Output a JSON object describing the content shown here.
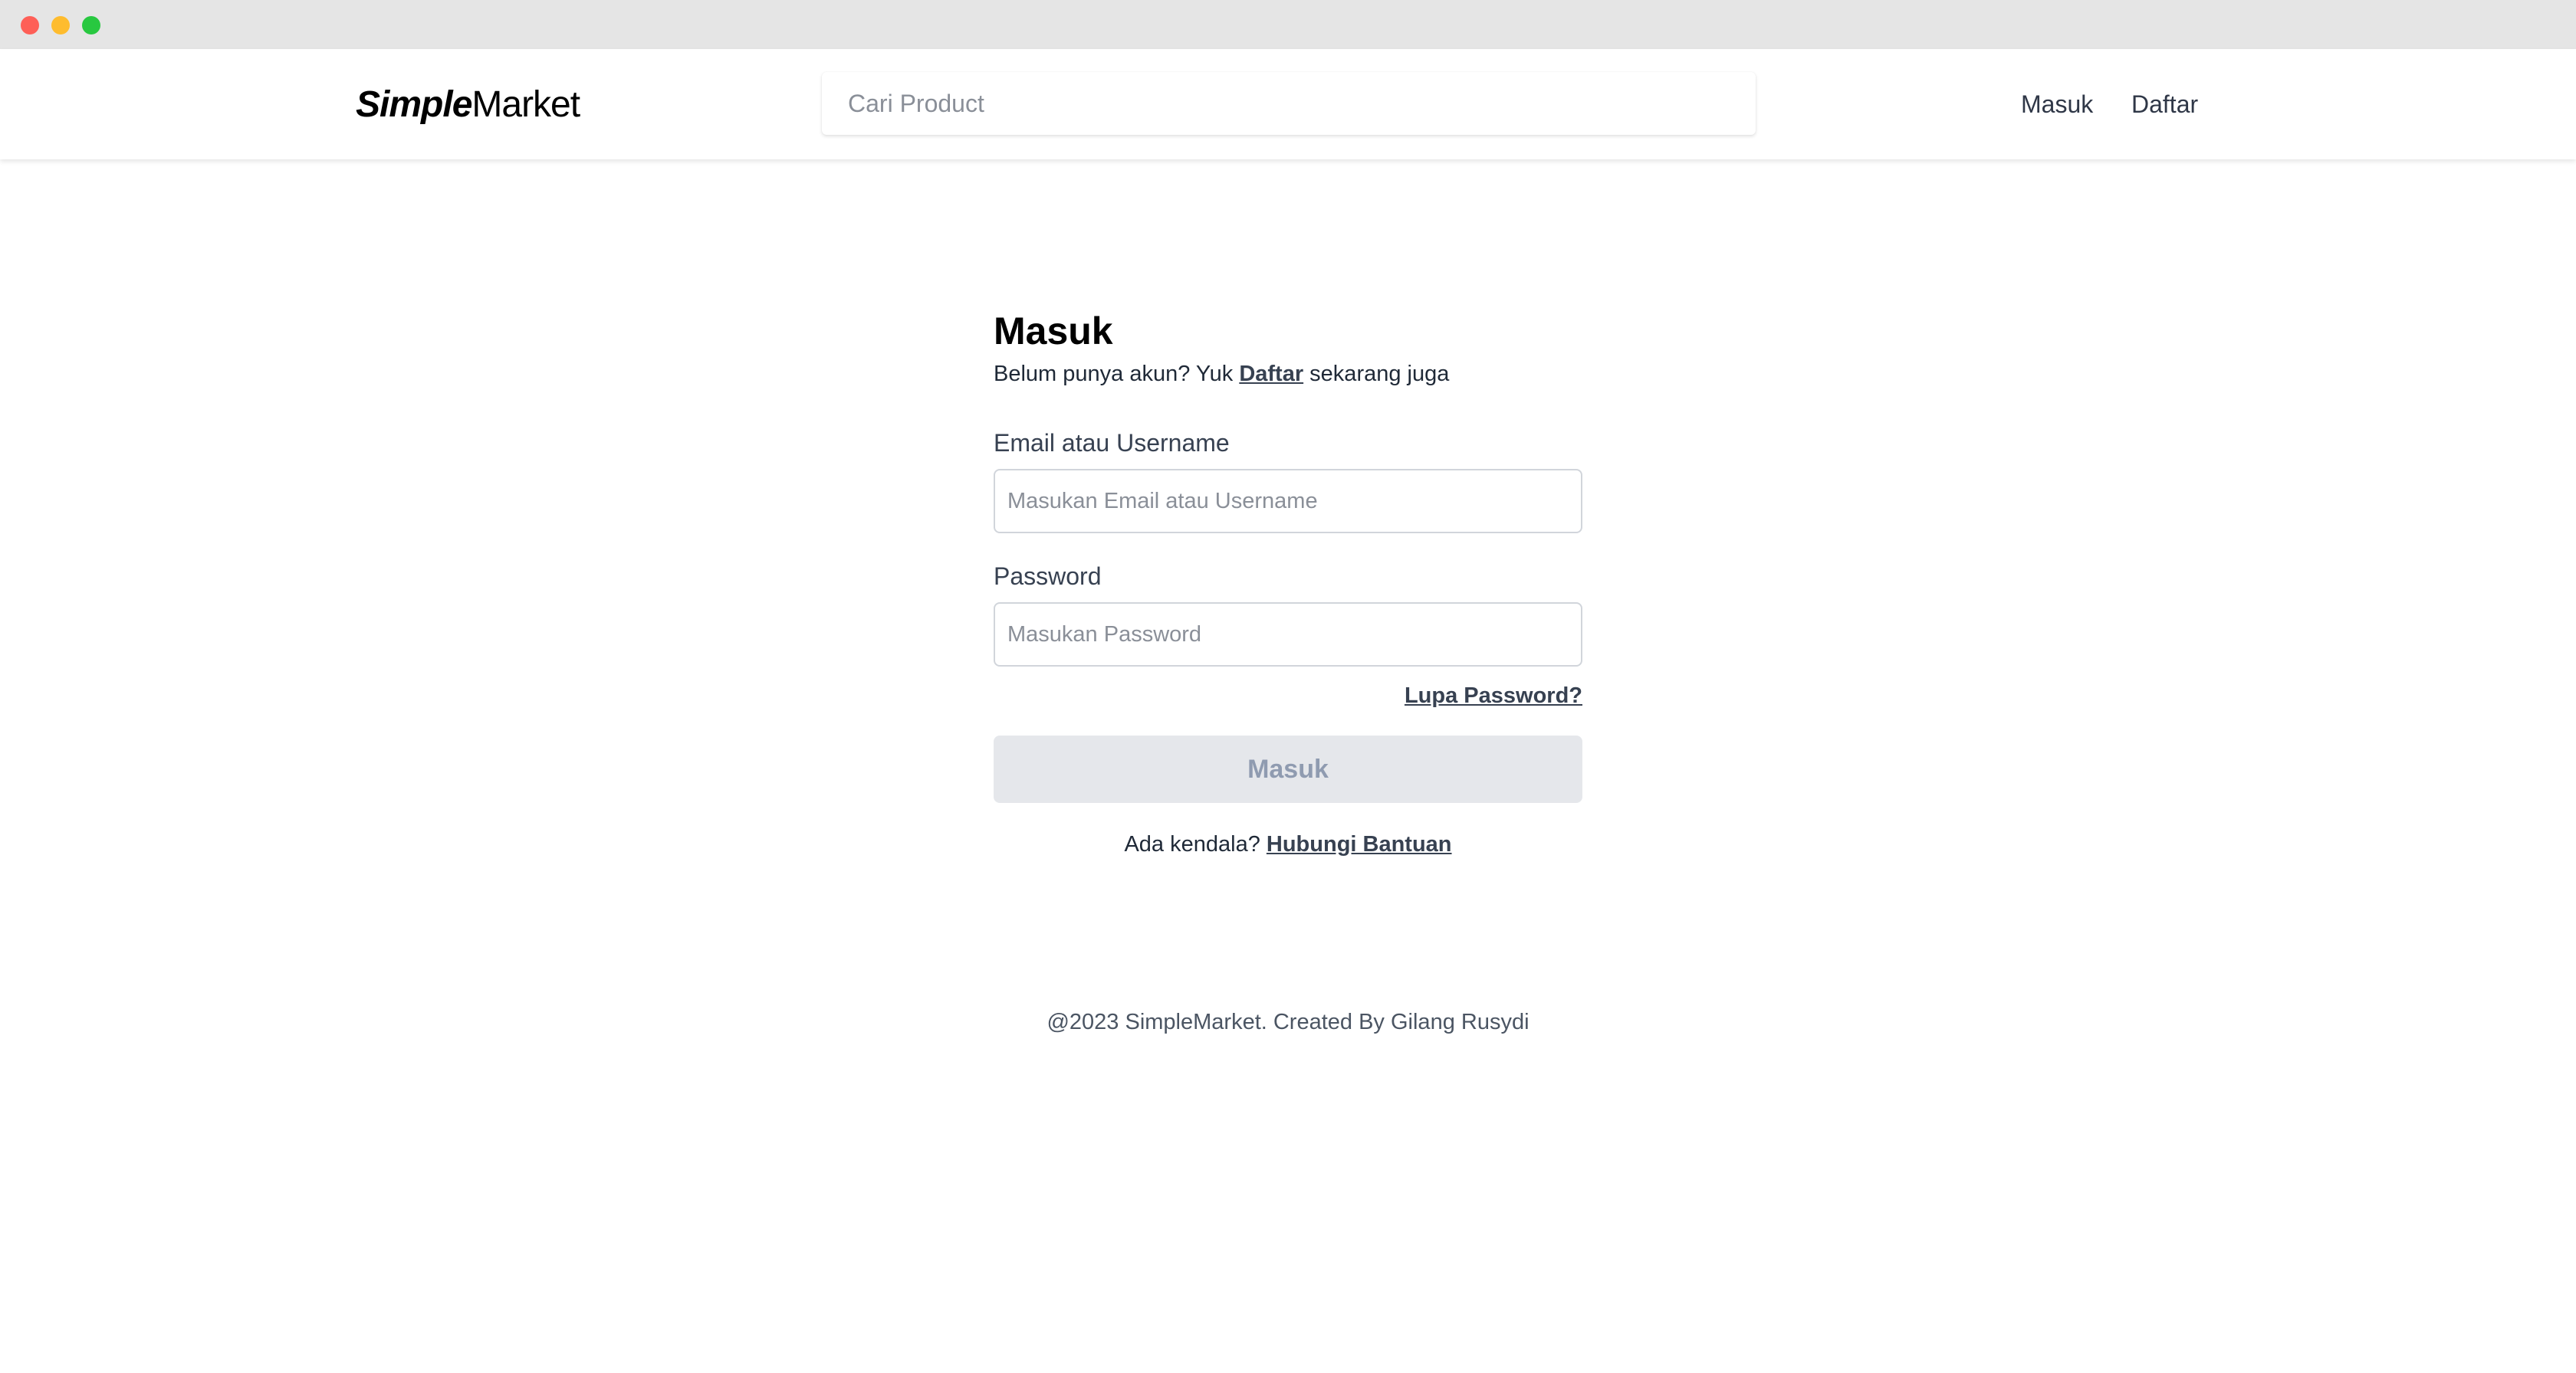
{
  "header": {
    "logo_bold": "Simple",
    "logo_regular": "Market",
    "search_placeholder": "Cari Product",
    "nav_login": "Masuk",
    "nav_register": "Daftar"
  },
  "login": {
    "title": "Masuk",
    "subtitle_prefix": "Belum punya akun? Yuk ",
    "subtitle_link": "Daftar",
    "subtitle_suffix": " sekarang juga",
    "email_label": "Email atau Username",
    "email_placeholder": "Masukan Email atau Username",
    "email_value": "",
    "password_label": "Password",
    "password_placeholder": "Masukan Password",
    "password_value": "",
    "forgot_link": "Lupa Password?",
    "submit_label": "Masuk",
    "help_prefix": "Ada kendala? ",
    "help_link": "Hubungi Bantuan"
  },
  "footer": {
    "text": "@2023 SimpleMarket. Created By Gilang Rusydi"
  },
  "colors": {
    "titlebar": "#e5e5e5",
    "close": "#fe5f57",
    "minimize": "#febc2e",
    "maximize": "#28c840",
    "button_disabled_bg": "#e5e7eb",
    "button_disabled_text": "#8f9bb0"
  }
}
